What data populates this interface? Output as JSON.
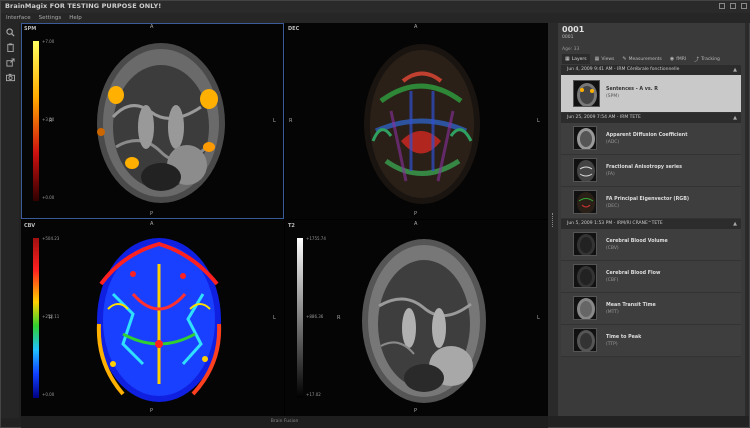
{
  "app": {
    "title": "BrainMagix FOR TESTING PURPOSE ONLY!",
    "menu": [
      "Interface",
      "Settings",
      "Help"
    ]
  },
  "toolbar": {
    "tools": [
      "zoom-icon",
      "clipboard-icon",
      "export-icon",
      "camera-icon"
    ]
  },
  "viewports": [
    {
      "name": "SPM",
      "scale_max": "+7.00",
      "scale_mid": "+3.50",
      "scale_min": "+0.00",
      "orientation": {
        "top": "A",
        "bottom": "P",
        "left": "R",
        "right": "L"
      }
    },
    {
      "name": "DEC",
      "orientation": {
        "top": "A",
        "bottom": "P",
        "left": "R",
        "right": "L"
      }
    },
    {
      "name": "CBV",
      "scale_max": "+504.23",
      "scale_mid": "+252.11",
      "scale_min": "+0.00",
      "orientation": {
        "top": "A",
        "bottom": "P",
        "left": "R",
        "right": "L"
      }
    },
    {
      "name": "T2",
      "scale_max": "+1755.74",
      "scale_mid": "+886.36",
      "scale_min": "+17.02",
      "orientation": {
        "top": "A",
        "bottom": "P",
        "left": "R",
        "right": "L"
      }
    }
  ],
  "status": {
    "text": "Brain Fusion"
  },
  "patient": {
    "id": "0001",
    "sub": "0001",
    "age": "Age: 33"
  },
  "tabs": [
    {
      "label": "Layers",
      "icon": "layers-icon",
      "active": true
    },
    {
      "label": "Views",
      "icon": "views-icon",
      "active": false
    },
    {
      "label": "Measurements",
      "icon": "measure-icon",
      "active": false
    },
    {
      "label": "fMRI",
      "icon": "fmri-icon",
      "active": false
    },
    {
      "label": "Tracking",
      "icon": "tracking-icon",
      "active": false
    }
  ],
  "sessions": [
    {
      "label": "Jun 4, 2009 9:41 AM - IRM Cérébrale fonctionnelle",
      "items": [
        {
          "name": "Sentences - A vs. R",
          "abbr": "(SPM)",
          "selected": true
        }
      ]
    },
    {
      "label": "Jun 25, 2009 7:54 AM - IRM TETE",
      "items": [
        {
          "name": "Apparent Diffusion Coefficient",
          "abbr": "(ADC)",
          "selected": false
        },
        {
          "name": "Fractional Anisotropy series",
          "abbr": "(FA)",
          "selected": false
        },
        {
          "name": "FA Principal Eigenvector (RGB)",
          "abbr": "(DEC)",
          "selected": false
        }
      ]
    },
    {
      "label": "Jun 5, 2009 1:53 PM - IRM/RI CRANE^TETE",
      "items": [
        {
          "name": "Cerebral Blood Volume",
          "abbr": "(CBV)",
          "selected": false
        },
        {
          "name": "Cerebral Blood Flow",
          "abbr": "(CBF)",
          "selected": false
        },
        {
          "name": "Mean Transit Time",
          "abbr": "(MTT)",
          "selected": false
        },
        {
          "name": "Time to Peak",
          "abbr": "(TTP)",
          "selected": false
        }
      ]
    }
  ]
}
